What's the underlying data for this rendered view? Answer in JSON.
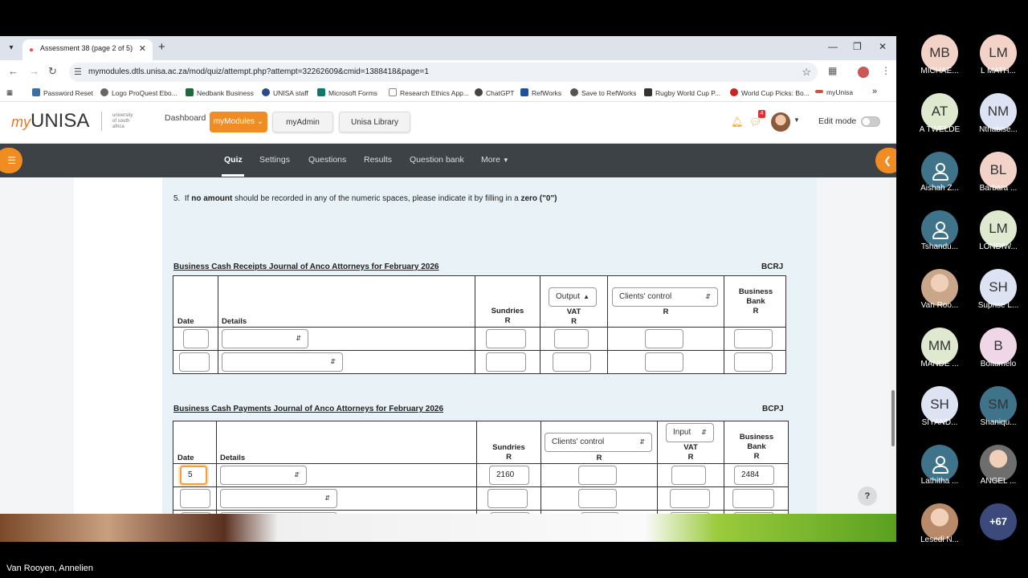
{
  "browser": {
    "tab_title": "Assessment 38 (page 2 of 5)",
    "url": "mymodules.dtls.unisa.ac.za/mod/quiz/attempt.php?attempt=32262609&cmid=1388418&page=1",
    "bookmarks": [
      "Password Reset",
      "Logo ProQuest Ebo...",
      "Nedbank Business",
      "UNISA staff",
      "Microsoft Forms",
      "Research Ethics App...",
      "ChatGPT",
      "RefWorks",
      "Save to RefWorks",
      "Rugby World Cup P...",
      "World Cup Picks: Bo...",
      "myUnisa"
    ]
  },
  "header": {
    "logo_my": "my",
    "logo_unisa": "UNISA",
    "logo_sub": "university of south africa",
    "nav": {
      "dashboard": "Dashboard",
      "mymodules": "myModules",
      "myadmin": "myAdmin",
      "library": "Unisa Library"
    },
    "notification_count": "4",
    "edit_mode": "Edit mode"
  },
  "course_nav": {
    "items": [
      "Quiz",
      "Settings",
      "Questions",
      "Results",
      "Question bank",
      "More"
    ]
  },
  "quiz": {
    "instruction_num": "5.",
    "instruction_pre": "If",
    "instruction_b1": "no amount",
    "instruction_mid": "should be recorded in any of the numeric spaces, please indicate it by filling in a",
    "instruction_b2": "zero (\"0\")",
    "crj": {
      "title": "Business Cash Receipts Journal of Anco Attorneys for February 2026",
      "code": "BCRJ",
      "headers": {
        "date": "Date",
        "details": "Details",
        "sundries": "Sundries",
        "r": "R",
        "vat_select": "Output",
        "vat": "VAT",
        "clients_select": "Clients' control",
        "bank_1": "Business",
        "bank_2": "Bank"
      }
    },
    "cpj": {
      "title": "Business Cash Payments Journal of Anco Attorneys for February 2026",
      "code": "BCPJ",
      "headers": {
        "date": "Date",
        "details": "Details",
        "sundries": "Sundries",
        "r": "R",
        "clients_select": "Clients' control",
        "vat_select": "Input",
        "vat": "VAT",
        "bank_1": "Business",
        "bank_2": "Bank"
      },
      "row1": {
        "date": "5",
        "sundries": "2160",
        "bank": "2484"
      }
    },
    "help": "?"
  },
  "participants": [
    {
      "initials": "MB",
      "name": "MICHAE...",
      "color": "#f3d3c8",
      "avatar_type": "initials"
    },
    {
      "initials": "LM",
      "name": "L MATH...",
      "color": "#f3d3c8",
      "avatar_type": "initials"
    },
    {
      "initials": "AT",
      "name": "A TWELDE",
      "color": "#dfe9d0",
      "avatar_type": "initials"
    },
    {
      "initials": "NM",
      "name": "Nthabise...",
      "color": "#dde3f3",
      "avatar_type": "initials"
    },
    {
      "initials": "",
      "name": "Aishah Z...",
      "color": "#3f7389",
      "avatar_type": "user"
    },
    {
      "initials": "BL",
      "name": "Barbara ...",
      "color": "#f3d3c8",
      "avatar_type": "initials"
    },
    {
      "initials": "",
      "name": "Tshandu...",
      "color": "#3f7389",
      "avatar_type": "user"
    },
    {
      "initials": "LM",
      "name": "LONDIW...",
      "color": "#dfe9d0",
      "avatar_type": "initials"
    },
    {
      "initials": "",
      "name": "Van Roo...",
      "color": "#c9a58a",
      "avatar_type": "photo"
    },
    {
      "initials": "SH",
      "name": "Suprise L...",
      "color": "#dde3f3",
      "avatar_type": "initials"
    },
    {
      "initials": "MM",
      "name": "MANDE ...",
      "color": "#dfe9d0",
      "avatar_type": "initials"
    },
    {
      "initials": "B",
      "name": "Boitumelo",
      "color": "#efd7e8",
      "avatar_type": "initials"
    },
    {
      "initials": "SH",
      "name": "SIYAND...",
      "color": "#dde3f3",
      "avatar_type": "initials"
    },
    {
      "initials": "SM",
      "name": "Shaniqu...",
      "color": "#3f7389",
      "avatar_type": "initials"
    },
    {
      "initials": "",
      "name": "Lathitha ...",
      "color": "#3f7389",
      "avatar_type": "user"
    },
    {
      "initials": "",
      "name": "ANGEL ...",
      "color": "#6e6e6e",
      "avatar_type": "photo"
    },
    {
      "initials": "",
      "name": "Lesedi N...",
      "color": "#b98a6a",
      "avatar_type": "photo"
    },
    {
      "initials": "+67",
      "name": "",
      "color": "#3b4a7a",
      "avatar_type": "more"
    }
  ],
  "meeting": {
    "active_speaker": "Van Rooyen, Annelien"
  }
}
